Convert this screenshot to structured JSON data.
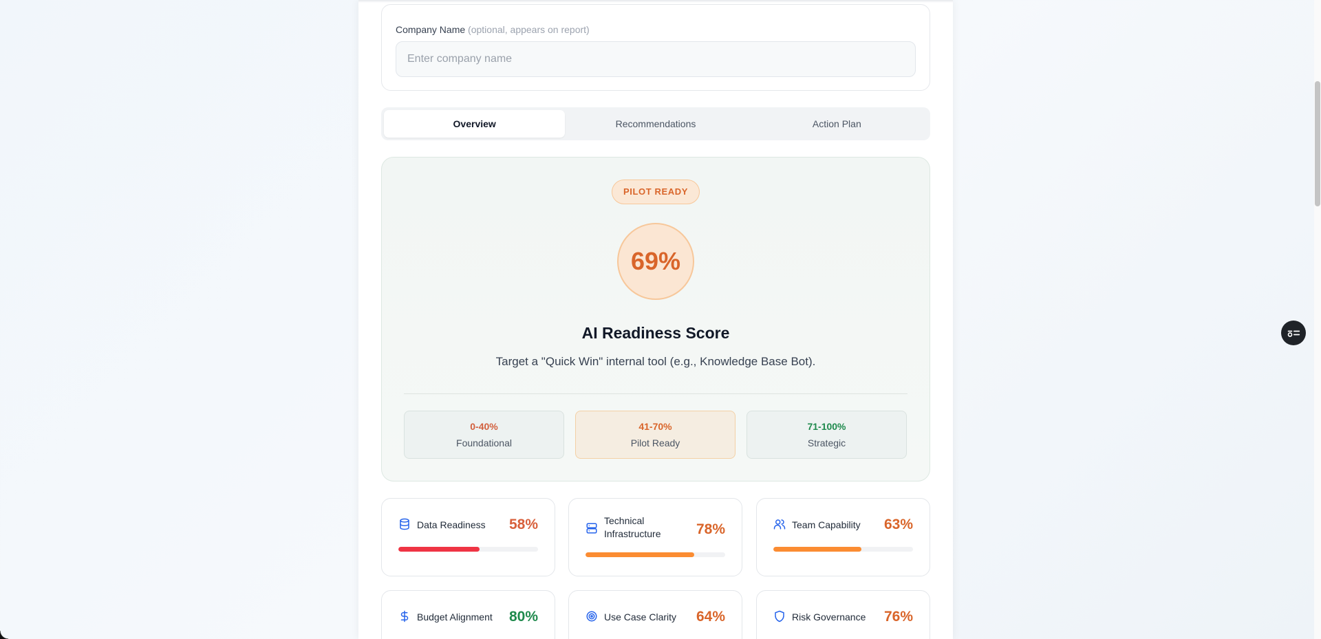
{
  "company": {
    "label": "Company Name",
    "hint": "(optional, appears on report)",
    "placeholder": "Enter company name",
    "value": ""
  },
  "tabs": [
    {
      "label": "Overview",
      "active": true
    },
    {
      "label": "Recommendations",
      "active": false
    },
    {
      "label": "Action Plan",
      "active": false
    }
  ],
  "score": {
    "badge": "PILOT READY",
    "value": "69%",
    "title": "AI Readiness Score",
    "subtitle": "Target a \"Quick Win\" internal tool (e.g., Knowledge Base Bot)."
  },
  "ranges": [
    {
      "range": "0-40%",
      "label": "Foundational"
    },
    {
      "range": "41-70%",
      "label": "Pilot Ready"
    },
    {
      "range": "71-100%",
      "label": "Strategic"
    }
  ],
  "metrics": [
    {
      "label": "Data Readiness",
      "value": "58%",
      "progress": 0.58,
      "color": "#ef3444",
      "text_color": "#d8603c",
      "icon": "database-icon"
    },
    {
      "label": "Technical Infrastructure",
      "value": "78%",
      "progress": 0.78,
      "color": "#fb8c32",
      "text_color": "#d9652a",
      "icon": "server-icon"
    },
    {
      "label": "Team Capability",
      "value": "63%",
      "progress": 0.63,
      "color": "#fb8c32",
      "text_color": "#d9652a",
      "icon": "users-icon"
    },
    {
      "label": "Budget Alignment",
      "value": "80%",
      "progress": 0.8,
      "color": "#22b45a",
      "text_color": "#1f8a4d",
      "icon": "dollar-icon"
    },
    {
      "label": "Use Case Clarity",
      "value": "64%",
      "progress": 0.64,
      "color": "#fb8c32",
      "text_color": "#d9652a",
      "icon": "target-icon"
    },
    {
      "label": "Risk Governance",
      "value": "76%",
      "progress": 0.76,
      "color": "#fb8c32",
      "text_color": "#d9652a",
      "icon": "shield-icon"
    }
  ],
  "colors": {
    "accent_orange": "#d9652a",
    "accent_green": "#1f8a4d",
    "icon_blue": "#2563eb"
  }
}
